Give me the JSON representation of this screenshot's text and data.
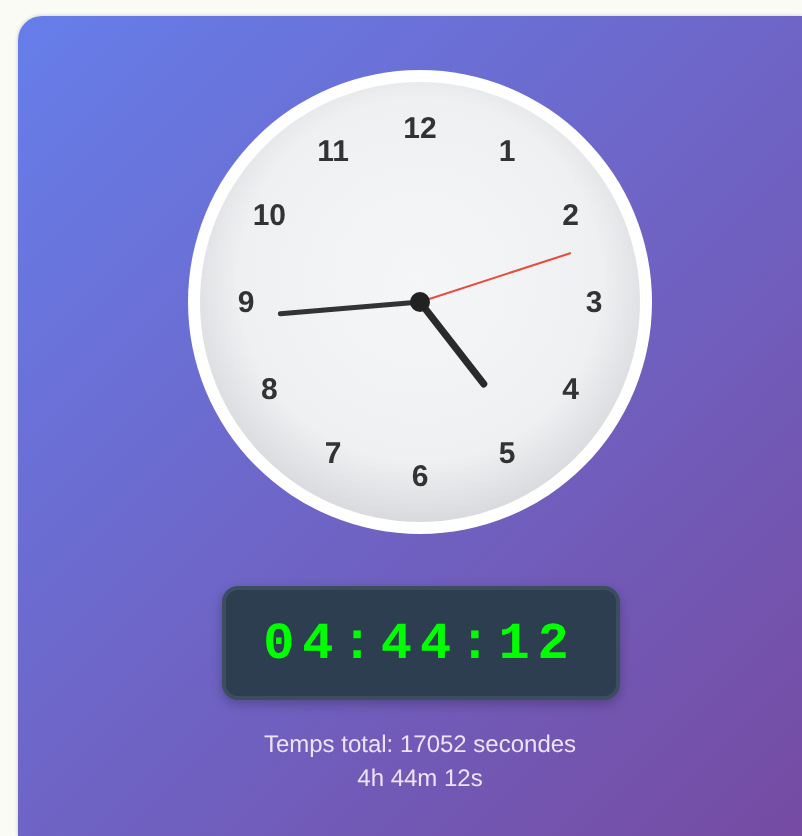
{
  "clock": {
    "numbers": [
      "12",
      "1",
      "2",
      "3",
      "4",
      "5",
      "6",
      "7",
      "8",
      "9",
      "10",
      "11"
    ]
  },
  "digital": "04:44:12",
  "total": "Temps total: 17052 secondes",
  "breakdown": "4h 44m 12s"
}
